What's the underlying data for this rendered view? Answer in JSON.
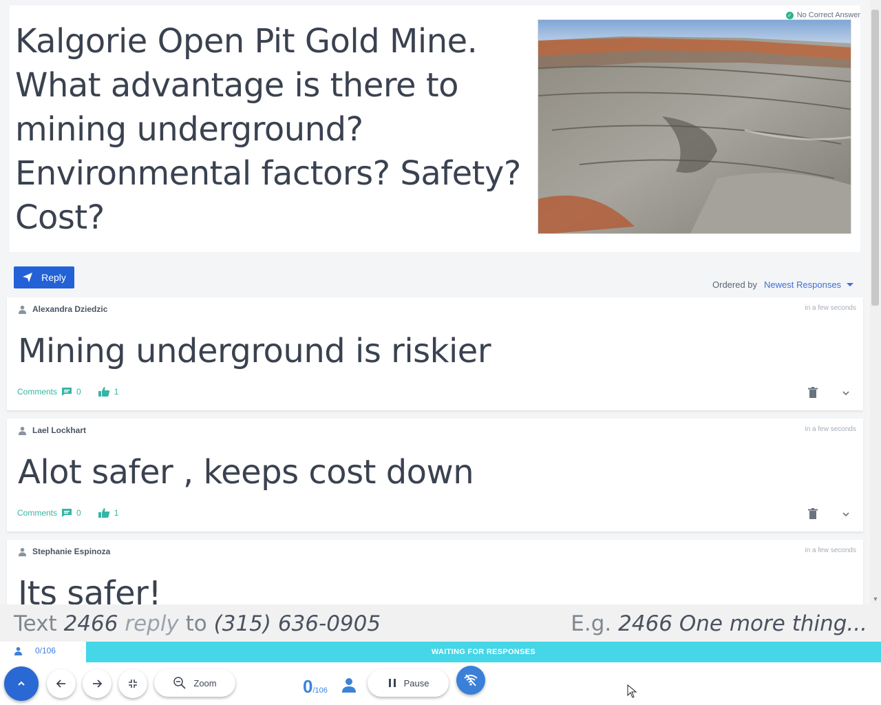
{
  "question": {
    "text": "Kalgorie Open Pit Gold Mine.  What advantage is there to mining underground?  Environmental factors? Safety? Cost?",
    "badge": "No Correct Answer"
  },
  "reply_button": {
    "label": "Reply"
  },
  "ordering": {
    "label": "Ordered by",
    "value": "Newest Responses"
  },
  "responses": [
    {
      "author": "Alexandra Dziedzic",
      "time": "in a few seconds",
      "text": "Mining underground is riskier",
      "comments_label": "Comments",
      "comments_count": "0",
      "likes": "1"
    },
    {
      "author": "Lael Lockhart",
      "time": "in a few seconds",
      "text": "Alot safer , keeps cost down",
      "comments_label": "Comments",
      "comments_count": "0",
      "likes": "1"
    },
    {
      "author": "Stephanie Espinoza",
      "time": "in a few seconds",
      "text": "Its safer!"
    }
  ],
  "text_bar": {
    "prefix": "Text",
    "code": "2466",
    "reply_word": "reply",
    "to_word": "to",
    "phone": "(315) 636-0905",
    "example_prefix": "E.g.",
    "example_text": "2466 One more thing..."
  },
  "status": {
    "responses_count": "0/106",
    "waiting_label": "WAITING FOR RESPONSES"
  },
  "toolbar": {
    "zoom_label": "Zoom",
    "pause_label": "Pause",
    "counter_big": "0",
    "counter_small": "/106"
  },
  "colors": {
    "primary": "#2262d6",
    "accent_teal": "#36b5a6",
    "waiting_bar": "#45d6e8",
    "badge_green": "#2bb58d"
  },
  "icons": [
    "send-icon",
    "person-icon",
    "comment-icon",
    "thumbs-up-icon",
    "trash-icon",
    "chevron-down-icon",
    "chevron-up-icon",
    "arrow-left-icon",
    "arrow-right-icon",
    "compress-icon",
    "zoom-out-icon",
    "pause-icon",
    "wifi-off-icon",
    "check-circle-icon"
  ]
}
